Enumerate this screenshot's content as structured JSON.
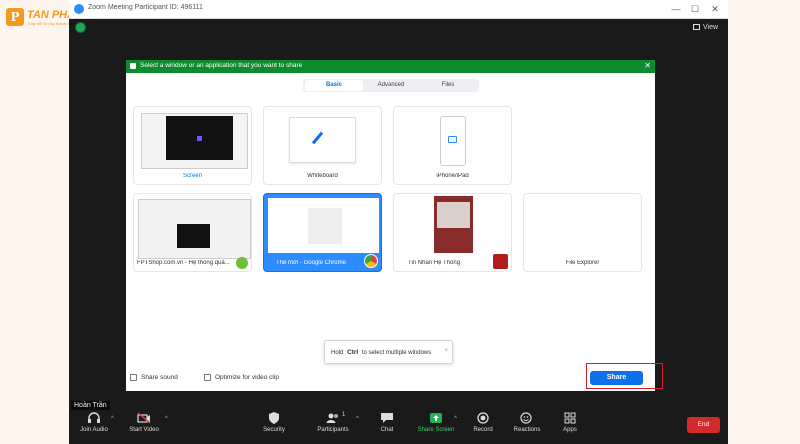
{
  "brand": {
    "mark": "P",
    "name": "TAN PHAT",
    "tagline": "Thay đổi tư duy thành công"
  },
  "window": {
    "title": "Zoom Meeting Participant ID: 496111",
    "controls": {
      "minimize": "—",
      "maximize": "☐",
      "close": "✕"
    },
    "view_label": "View"
  },
  "dialog": {
    "title": "Select a window or an application that you want to share",
    "tabs": [
      {
        "label": "Basic",
        "active": true
      },
      {
        "label": "Advanced",
        "active": false
      },
      {
        "label": "Files",
        "active": false
      }
    ],
    "tiles": [
      {
        "label": "Screen"
      },
      {
        "label": "Whiteboard"
      },
      {
        "label": "iPhone/iPad"
      },
      {
        "label": "FPTShop.com.vn - Hệ thống quả..."
      },
      {
        "label": "Thẻ mới - Google Chrome",
        "selected": true
      },
      {
        "label": "Tin Nhắn Hệ Thống"
      },
      {
        "label": "File Explorer"
      }
    ],
    "tooltip": {
      "prefix": "Hold",
      "key": "Ctrl",
      "suffix": "to select multiple windows",
      "close": "×"
    },
    "share_sound_label": "Share sound",
    "optimize_label": "Optimize for video clip",
    "share_button": "Share"
  },
  "participant_name": "Hoàn Trần",
  "toolbar": {
    "join_audio": "Join Audio",
    "start_video": "Start Video",
    "security": "Security",
    "participants": "Participants",
    "participants_count": "1",
    "chat": "Chat",
    "share_screen": "Share Screen",
    "record": "Record",
    "reactions": "Reactions",
    "apps": "Apps",
    "end": "End"
  },
  "colors": {
    "dialog_header": "#0e8a2f",
    "primary": "#0e71eb",
    "highlight": "#d61f26",
    "end": "#d42a2a",
    "share_green": "#3bd671"
  }
}
